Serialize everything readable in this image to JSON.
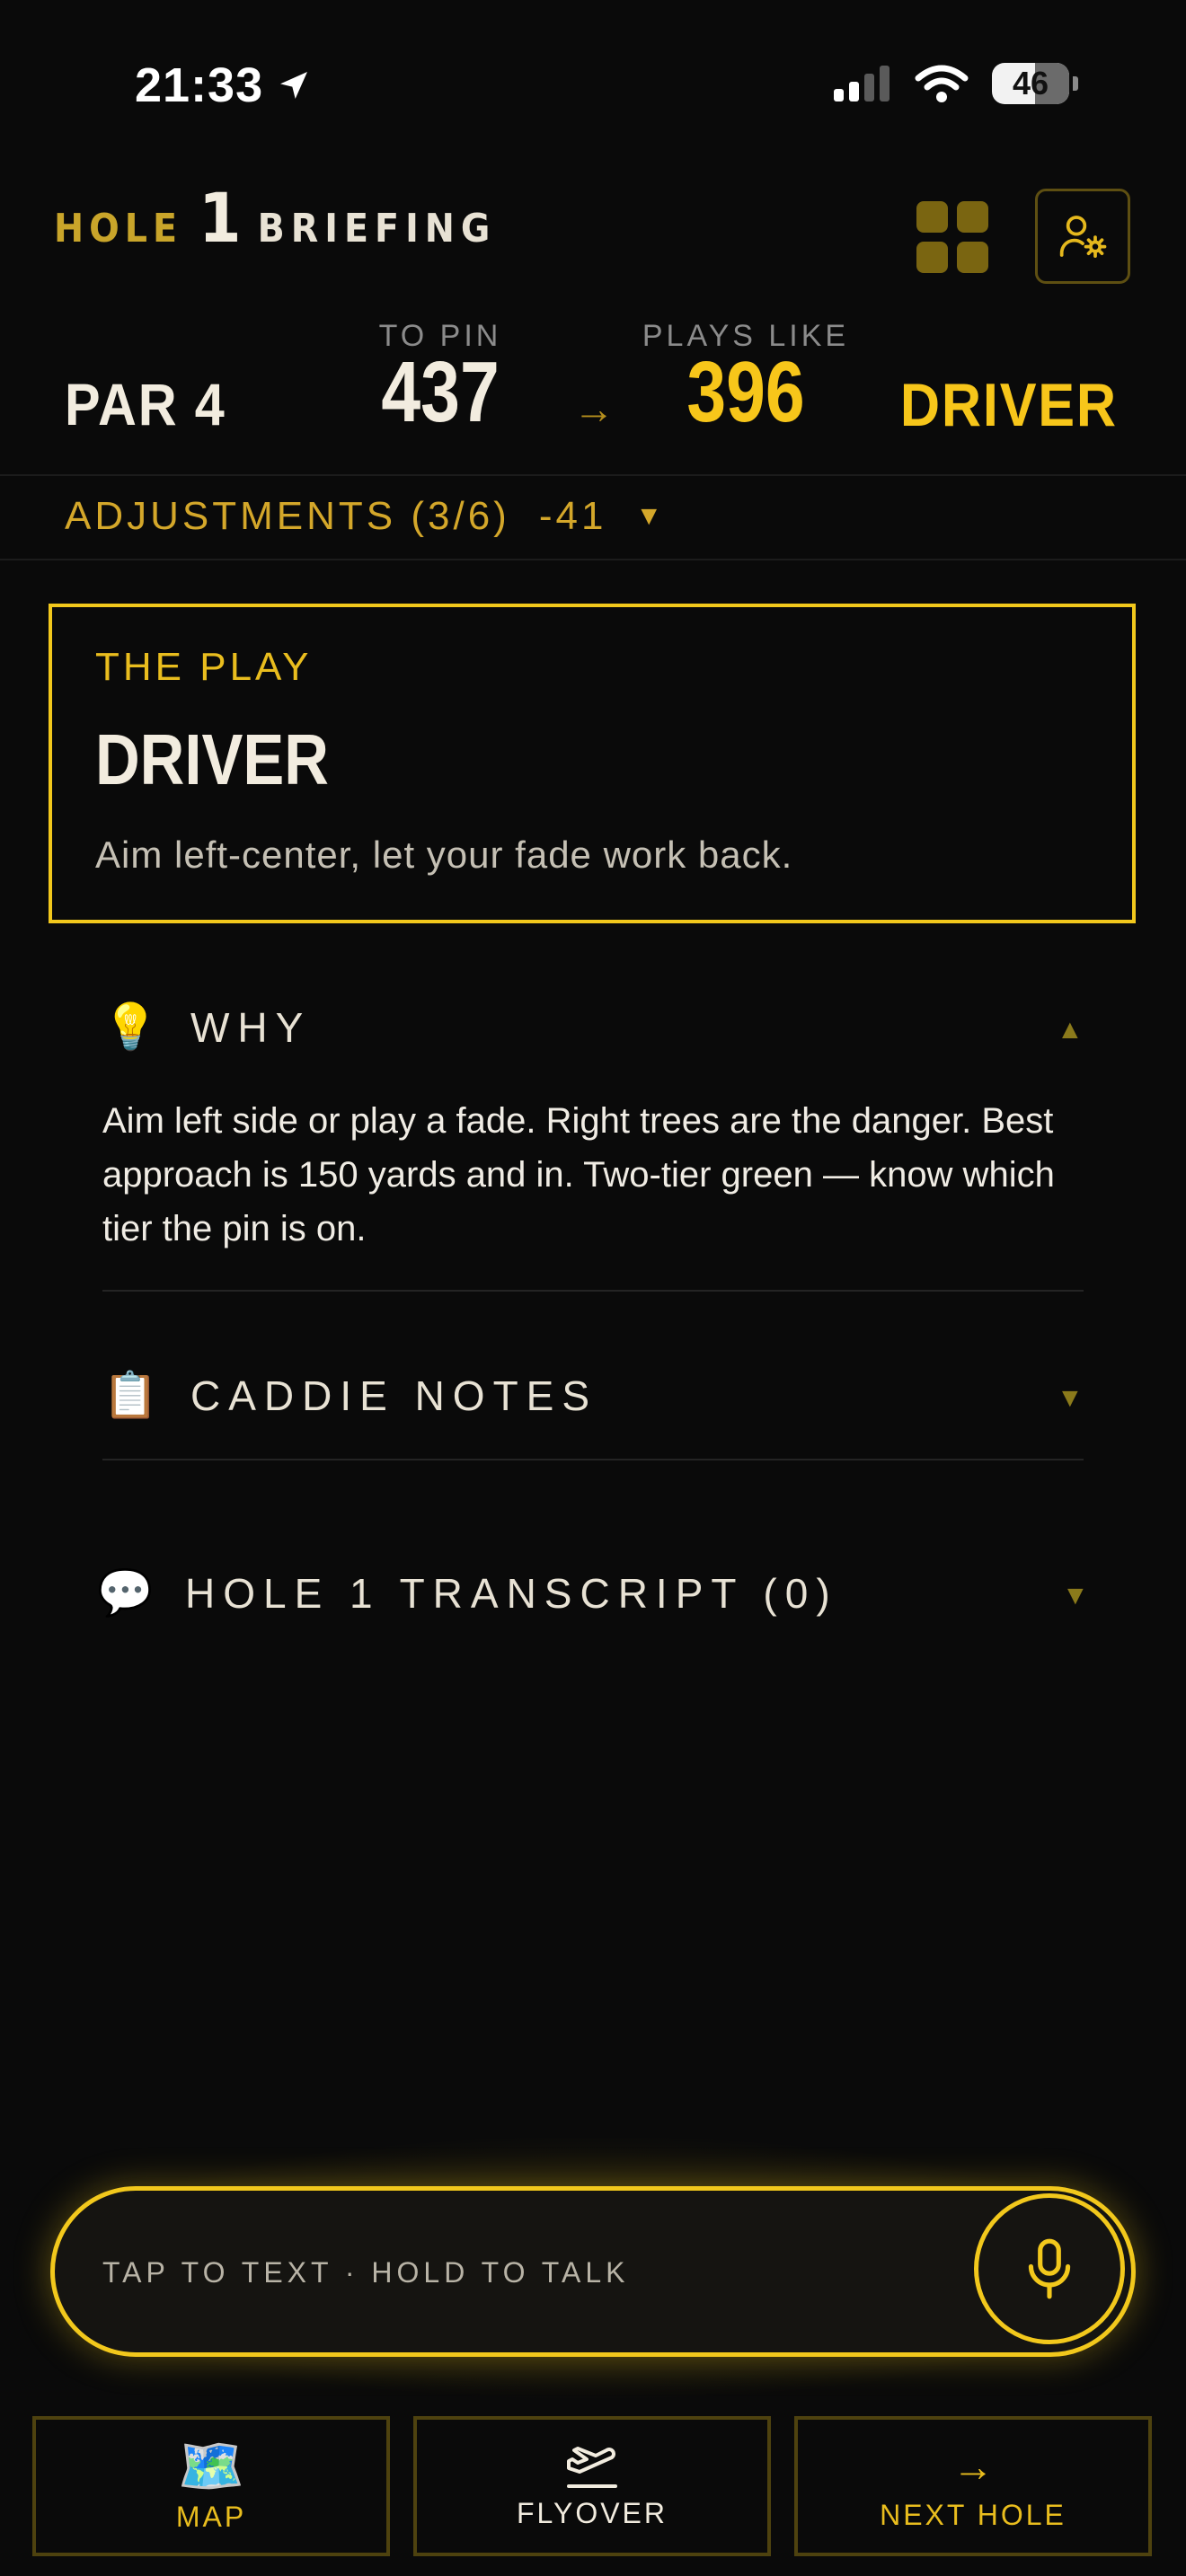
{
  "status_bar": {
    "time": "21:33",
    "battery": "46",
    "icons": [
      "location-arrow-icon",
      "signal-icon",
      "wifi-icon",
      "battery-icon"
    ]
  },
  "header": {
    "hole_label": "HOLE",
    "hole_number": "1",
    "title": "BRIEFING",
    "icons": [
      "grid-icon",
      "player-settings-icon"
    ]
  },
  "yardage": {
    "par": "PAR 4",
    "to_pin_label": "TO PIN",
    "to_pin_value": "437",
    "arrow": "→",
    "plays_like_label": "PLAYS LIKE",
    "plays_like_value": "396",
    "club": "DRIVER"
  },
  "adjustments": {
    "label": "ADJUSTMENTS (3/6)",
    "value": "-41",
    "caret": "▼"
  },
  "play": {
    "label": "THE PLAY",
    "club": "DRIVER",
    "description": "Aim left-center, let your fade work back."
  },
  "sections": {
    "why": {
      "icon": "💡",
      "title": "WHY",
      "chevron": "▲",
      "body": "Aim left side or play a fade. Right trees are the danger. Best approach is 150 yards and in. Two-tier green — know which tier the pin is on."
    },
    "caddie_notes": {
      "icon": "📋",
      "title": "CADDIE NOTES",
      "chevron": "▼"
    },
    "transcript": {
      "icon": "💬",
      "title": "HOLE 1 TRANSCRIPT (0)",
      "chevron": "▼"
    }
  },
  "talk_bar": {
    "placeholder": "TAP TO TEXT · HOLD TO TALK"
  },
  "bottom_nav": [
    {
      "icon": "🗺️",
      "label": "MAP"
    },
    {
      "icon": "flyover-plane-icon",
      "label": "FLYOVER"
    },
    {
      "icon": "→",
      "label": "NEXT HOLE"
    }
  ],
  "colors": {
    "accent": "#f2c81c",
    "accent_dim": "#c9a52a",
    "background": "#0a0a0a",
    "text": "#f2ecdf"
  }
}
